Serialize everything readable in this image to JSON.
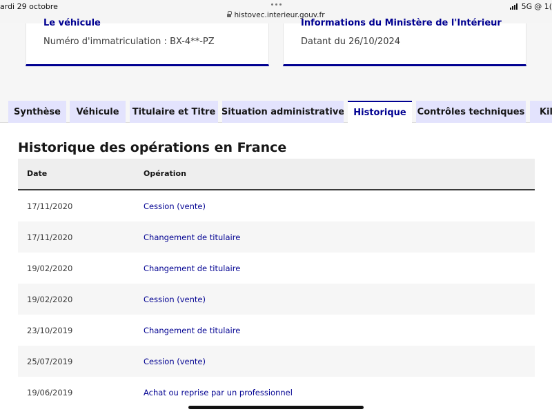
{
  "status_bar": {
    "date": "ardi 29 octobre",
    "network": "5G",
    "right_cut": "@ 1("
  },
  "browser": {
    "url": "histovec.interieur.gouv.fr"
  },
  "cards": [
    {
      "title": "Le véhicule",
      "text": "Numéro d'immatriculation : BX-4**-PZ"
    },
    {
      "title": "Informations du Ministère de l'Intérieur",
      "text": "Datant du 26/10/2024"
    }
  ],
  "tabs": [
    {
      "label": "Synthèse"
    },
    {
      "label": "Véhicule"
    },
    {
      "label": "Titulaire et Titre"
    },
    {
      "label": "Situation administrative"
    },
    {
      "label": "Historique"
    },
    {
      "label": "Contrôles techniques"
    },
    {
      "label": "Kilo"
    }
  ],
  "active_tab": "Historique",
  "section": {
    "title": "Historique des opérations en France"
  },
  "table": {
    "headers": {
      "date": "Date",
      "operation": "Opération"
    },
    "rows": [
      {
        "date": "17/11/2020",
        "operation": "Cession (vente)"
      },
      {
        "date": "17/11/2020",
        "operation": "Changement de titulaire"
      },
      {
        "date": "19/02/2020",
        "operation": "Changement de titulaire"
      },
      {
        "date": "19/02/2020",
        "operation": "Cession (vente)"
      },
      {
        "date": "23/10/2019",
        "operation": "Changement de titulaire"
      },
      {
        "date": "25/07/2019",
        "operation": "Cession (vente)"
      },
      {
        "date": "19/06/2019",
        "operation": "Achat ou reprise par un professionnel"
      }
    ]
  },
  "colors": {
    "accent": "#000091",
    "tab_bg": "#e3e3fd",
    "row_alt": "#f6f6f6"
  }
}
